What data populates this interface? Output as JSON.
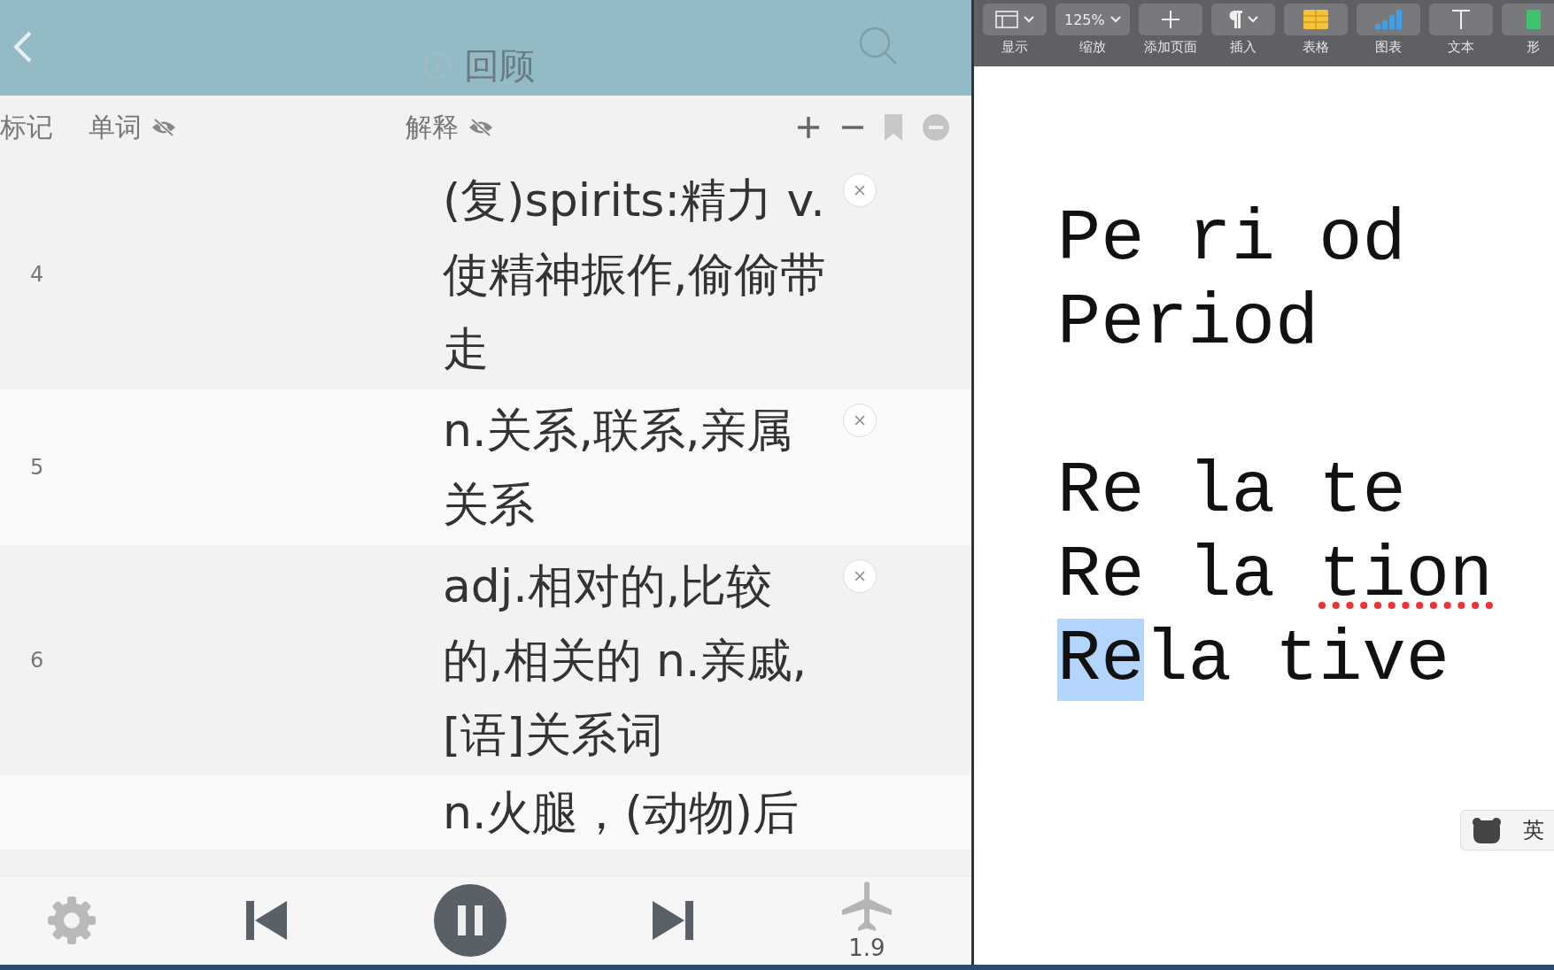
{
  "app": {
    "title": "回顾",
    "columns": [
      {
        "label": "标记",
        "hidden_icon": false
      },
      {
        "label": "单词",
        "hidden_icon": true
      },
      {
        "label": "解释",
        "hidden_icon": true
      }
    ],
    "rows": [
      {
        "number": "4",
        "definition": "(复)spirits:精力 v.使精神振作,偷偷带走"
      },
      {
        "number": "5",
        "definition": "n.关系,联系,亲属关系"
      },
      {
        "number": "6",
        "definition": "adj.相对的,比较的,相关的 n.亲戚,[语]关系词"
      },
      {
        "number": "",
        "definition": "n.火腿，(动物)后"
      }
    ],
    "player": {
      "speed": "1.9"
    }
  },
  "editor": {
    "toolbar": [
      {
        "kind": "view",
        "label": "显示"
      },
      {
        "kind": "zoom",
        "value": "125%",
        "label": "缩放"
      },
      {
        "kind": "add",
        "label": "添加页面"
      },
      {
        "kind": "insert",
        "label": "插入"
      },
      {
        "kind": "table",
        "label": "表格"
      },
      {
        "kind": "chart",
        "label": "图表"
      },
      {
        "kind": "text",
        "label": "文本"
      },
      {
        "kind": "shape",
        "label": "形"
      }
    ],
    "paragraphs": [
      [
        [
          {
            "text": "Pe ri od",
            "selected": false,
            "misspelled": false
          }
        ],
        [
          {
            "text": "Period",
            "selected": false,
            "misspelled": false
          }
        ]
      ],
      [
        [
          {
            "text": "Re la te",
            "selected": false,
            "misspelled": false
          }
        ],
        [
          {
            "text": "Re la ",
            "selected": false,
            "misspelled": false
          },
          {
            "text": "tion",
            "selected": false,
            "misspelled": true
          }
        ],
        [
          {
            "text": "Re",
            "selected": true,
            "misspelled": false
          },
          {
            "text": "la tive",
            "selected": false,
            "misspelled": false
          }
        ]
      ]
    ],
    "ime": {
      "label": "英"
    }
  }
}
